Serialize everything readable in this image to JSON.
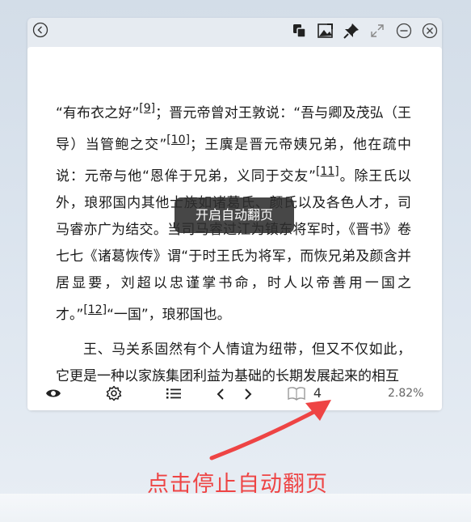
{
  "window": {
    "titlebar_icons": [
      "back-icon",
      "copy-icon",
      "image-edit-icon",
      "pin-icon",
      "expand-icon",
      "minimize-icon",
      "close-icon"
    ]
  },
  "content": {
    "p1": {
      "s1": "“有布衣之好”",
      "fn9": "[9]",
      "s2": "；晋元帝曾对王敦说：“吾与卿及茂弘（王导）当管鲍之交”",
      "fn10": "[10]",
      "s3": "；王廙是晋元帝姨兄弟，他在疏中说：元帝与他“恩侔于兄弟，义同于交友”",
      "fn11": "[11]",
      "s4": "。除王氏以外，琅邪国内其他士族如诸葛氏、颜氏以及各色人才，司马睿亦广为结交。",
      "s5": "当司马睿过江为镇东将军时，《晋书》卷七七《诸葛恢传》谓“于时王氏为将军，而恢兄弟及颜含并居显要，刘超以忠谨掌书命，时人以帝善用一国之才。”",
      "fn12": "[12]",
      "s6": "“一国”，琅邪国也。"
    },
    "p2": "王、马关系固然有个人情谊为纽带，但又不仅如此，它更是一种以家族集团利益为基础的长期发展起来的相互"
  },
  "toast": "开启自动翻页",
  "toolbar": {
    "page_number": "4",
    "progress_percent": "2.82%"
  },
  "annotation": {
    "caption": "点击停止自动翻页",
    "color": "#ee4444"
  }
}
